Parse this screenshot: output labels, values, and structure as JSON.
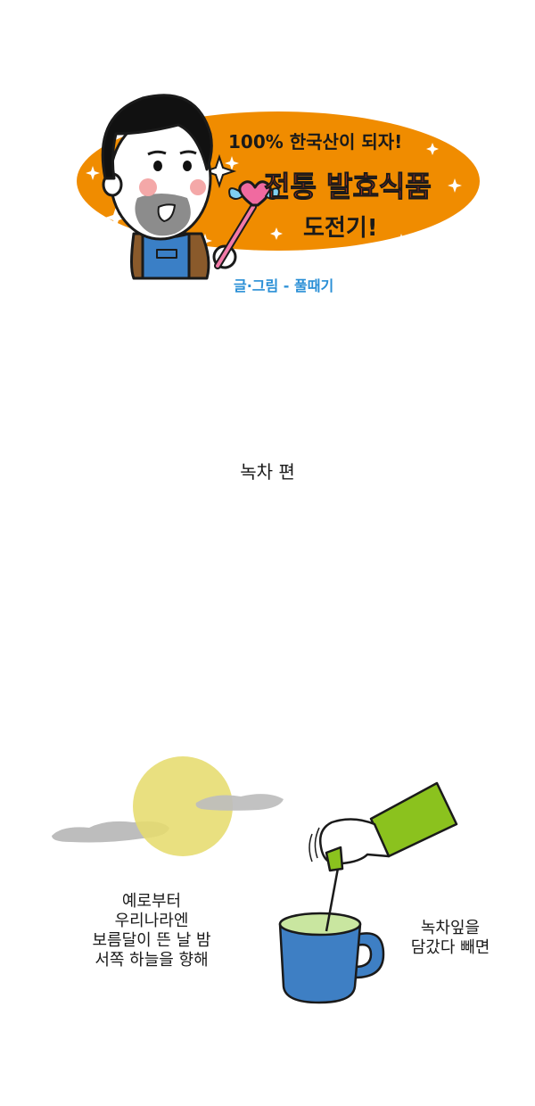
{
  "banner": {
    "subtitle": "100% 한국산이 되자!",
    "title_line1": "전통 발효식품",
    "title_line2": "도전기!",
    "credit": "글·그림 - 풀때기",
    "colors": {
      "oval": "#f08c00",
      "title": "#e23b1e",
      "credit": "#2a8fd6",
      "apron": "#3a7fc6"
    }
  },
  "episode_title": "녹차 편",
  "caption_left": [
    "예로부터",
    "우리나라엔",
    "보름달이 뜬 날 밤",
    "서쪽 하늘을 향해"
  ],
  "caption_right": [
    "녹차잎을",
    "담갔다 빼면"
  ],
  "colors": {
    "moon": "#e6dc6e",
    "cloud": "#bdbdbd",
    "mug": "#3e7fc4",
    "tea": "#c9e6a0",
    "sleeve": "#8bc21e"
  }
}
